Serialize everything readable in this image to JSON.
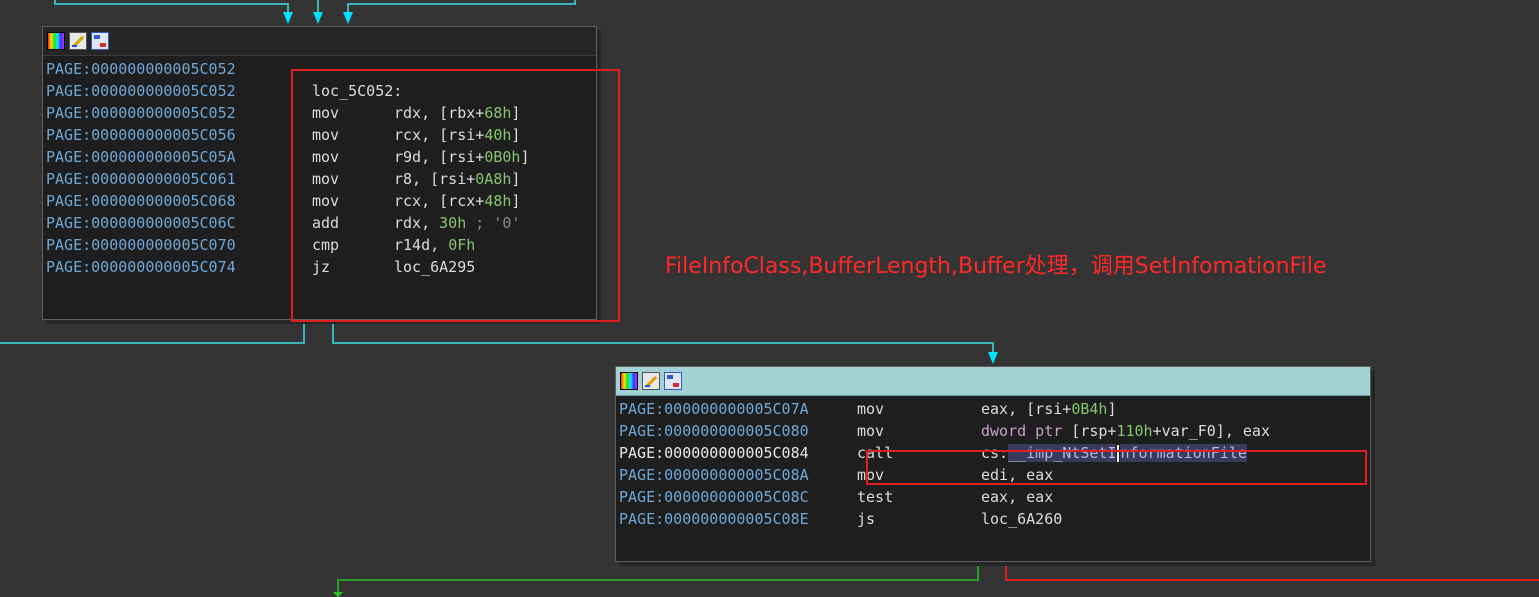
{
  "colors": {
    "background": "#343434",
    "node_body": "#1e1e1e",
    "address": "#6fa8d8",
    "number": "#86c56f",
    "edge_cyan": "#3ab4b8",
    "edge_green": "#2aa02a",
    "edge_red": "#e02020",
    "annotation_red": "#ff2828"
  },
  "header_icons": [
    "palette-icon",
    "edit-icon",
    "graph-icon"
  ],
  "node1": {
    "lines": [
      {
        "addr": "PAGE:000000000005C052",
        "mnem": "",
        "ops": [],
        "label": ""
      },
      {
        "addr": "PAGE:000000000005C052",
        "mnem": "",
        "ops": [],
        "label": "loc_5C052:"
      },
      {
        "addr": "PAGE:000000000005C052",
        "mnem": "mov",
        "ops": [
          {
            "t": "rdx, [rbx+"
          },
          {
            "t": "68h",
            "c": "num"
          },
          {
            "t": "]"
          }
        ]
      },
      {
        "addr": "PAGE:000000000005C056",
        "mnem": "mov",
        "ops": [
          {
            "t": "rcx, [rsi+"
          },
          {
            "t": "40h",
            "c": "num"
          },
          {
            "t": "]"
          }
        ]
      },
      {
        "addr": "PAGE:000000000005C05A",
        "mnem": "mov",
        "ops": [
          {
            "t": "r9d, [rsi+"
          },
          {
            "t": "0B0h",
            "c": "num"
          },
          {
            "t": "]"
          }
        ]
      },
      {
        "addr": "PAGE:000000000005C061",
        "mnem": "mov",
        "ops": [
          {
            "t": "r8, [rsi+"
          },
          {
            "t": "0A8h",
            "c": "num"
          },
          {
            "t": "]"
          }
        ]
      },
      {
        "addr": "PAGE:000000000005C068",
        "mnem": "mov",
        "ops": [
          {
            "t": "rcx, [rcx+"
          },
          {
            "t": "48h",
            "c": "num"
          },
          {
            "t": "]"
          }
        ]
      },
      {
        "addr": "PAGE:000000000005C06C",
        "mnem": "add",
        "ops": [
          {
            "t": "rdx, "
          },
          {
            "t": "30h",
            "c": "num"
          },
          {
            "t": " ; '0'",
            "c": "cmt"
          }
        ]
      },
      {
        "addr": "PAGE:000000000005C070",
        "mnem": "cmp",
        "ops": [
          {
            "t": "r14d, "
          },
          {
            "t": "0Fh",
            "c": "num"
          }
        ]
      },
      {
        "addr": "PAGE:000000000005C074",
        "mnem": "jz",
        "ops": [
          {
            "t": "loc_6A295"
          }
        ]
      }
    ]
  },
  "node2": {
    "lines": [
      {
        "addr": "PAGE:000000000005C07A",
        "mnem": "mov",
        "ops": [
          {
            "t": "eax, [rsi+"
          },
          {
            "t": "0B4h",
            "c": "num"
          },
          {
            "t": "]"
          }
        ]
      },
      {
        "addr": "PAGE:000000000005C080",
        "mnem": "mov",
        "ops": [
          {
            "t": "dword ptr",
            "c": "dim"
          },
          {
            "t": " [rsp+"
          },
          {
            "t": "110h",
            "c": "num"
          },
          {
            "t": "+var_F0], eax"
          }
        ]
      },
      {
        "addr": "PAGE:000000000005C084",
        "mnem": "call",
        "ops": [
          {
            "t": "cs:"
          },
          {
            "t": "__imp_NtSetI",
            "c": "sym"
          },
          {
            "cursor": true
          },
          {
            "t": "nformationFile",
            "c": "sym"
          }
        ],
        "highlight": true
      },
      {
        "addr": "PAGE:000000000005C08A",
        "mnem": "mov",
        "ops": [
          {
            "t": "edi, eax"
          }
        ]
      },
      {
        "addr": "PAGE:000000000005C08C",
        "mnem": "test",
        "ops": [
          {
            "t": "eax, eax"
          }
        ]
      },
      {
        "addr": "PAGE:000000000005C08E",
        "mnem": "js",
        "ops": [
          {
            "t": "loc_6A260"
          }
        ]
      }
    ]
  },
  "annotation": "FileInfoClass,BufferLength,Buffer处理，调用SetInfomationFile"
}
